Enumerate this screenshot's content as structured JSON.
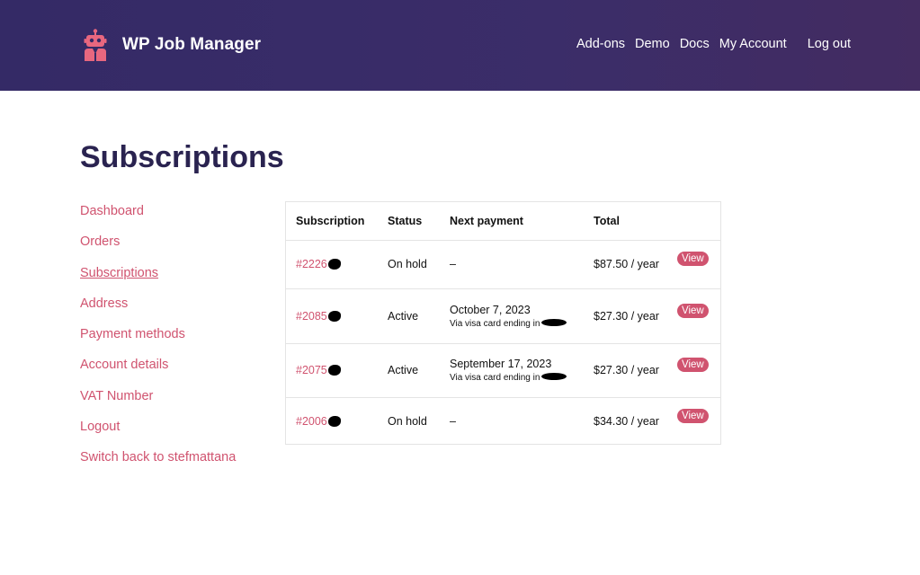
{
  "header": {
    "brand_name": "WP Job Manager",
    "colors": {
      "background_start": "#342a66",
      "background_end": "#432c61",
      "logo": "#e8677f"
    },
    "nav": [
      "Add-ons",
      "Demo",
      "Docs",
      "My Account",
      "Log out"
    ]
  },
  "page": {
    "title": "Subscriptions"
  },
  "sidebar": {
    "accent": "#d0536f",
    "items": [
      "Dashboard",
      "Orders",
      "Subscriptions",
      "Address",
      "Payment methods",
      "Account details",
      "VAT Number",
      "Logout",
      "Switch back to stefmattana"
    ],
    "active_index": 2
  },
  "table": {
    "headers": [
      "Subscription",
      "Status",
      "Next payment",
      "Total"
    ],
    "rows": [
      {
        "id": "#2226",
        "status": "On hold",
        "next_payment": "–",
        "via": "",
        "total": "$87.50 / year",
        "action": "View"
      },
      {
        "id": "#2085",
        "status": "Active",
        "next_payment": "October 7, 2023",
        "via": "Via visa card ending in",
        "total": "$27.30 / year",
        "action": "View"
      },
      {
        "id": "#2075",
        "status": "Active",
        "next_payment": "September 17, 2023",
        "via": "Via visa card ending in",
        "total": "$27.30 / year",
        "action": "View"
      },
      {
        "id": "#2006",
        "status": "On hold",
        "next_payment": "–",
        "via": "",
        "total": "$34.30 / year",
        "action": "View"
      }
    ]
  }
}
